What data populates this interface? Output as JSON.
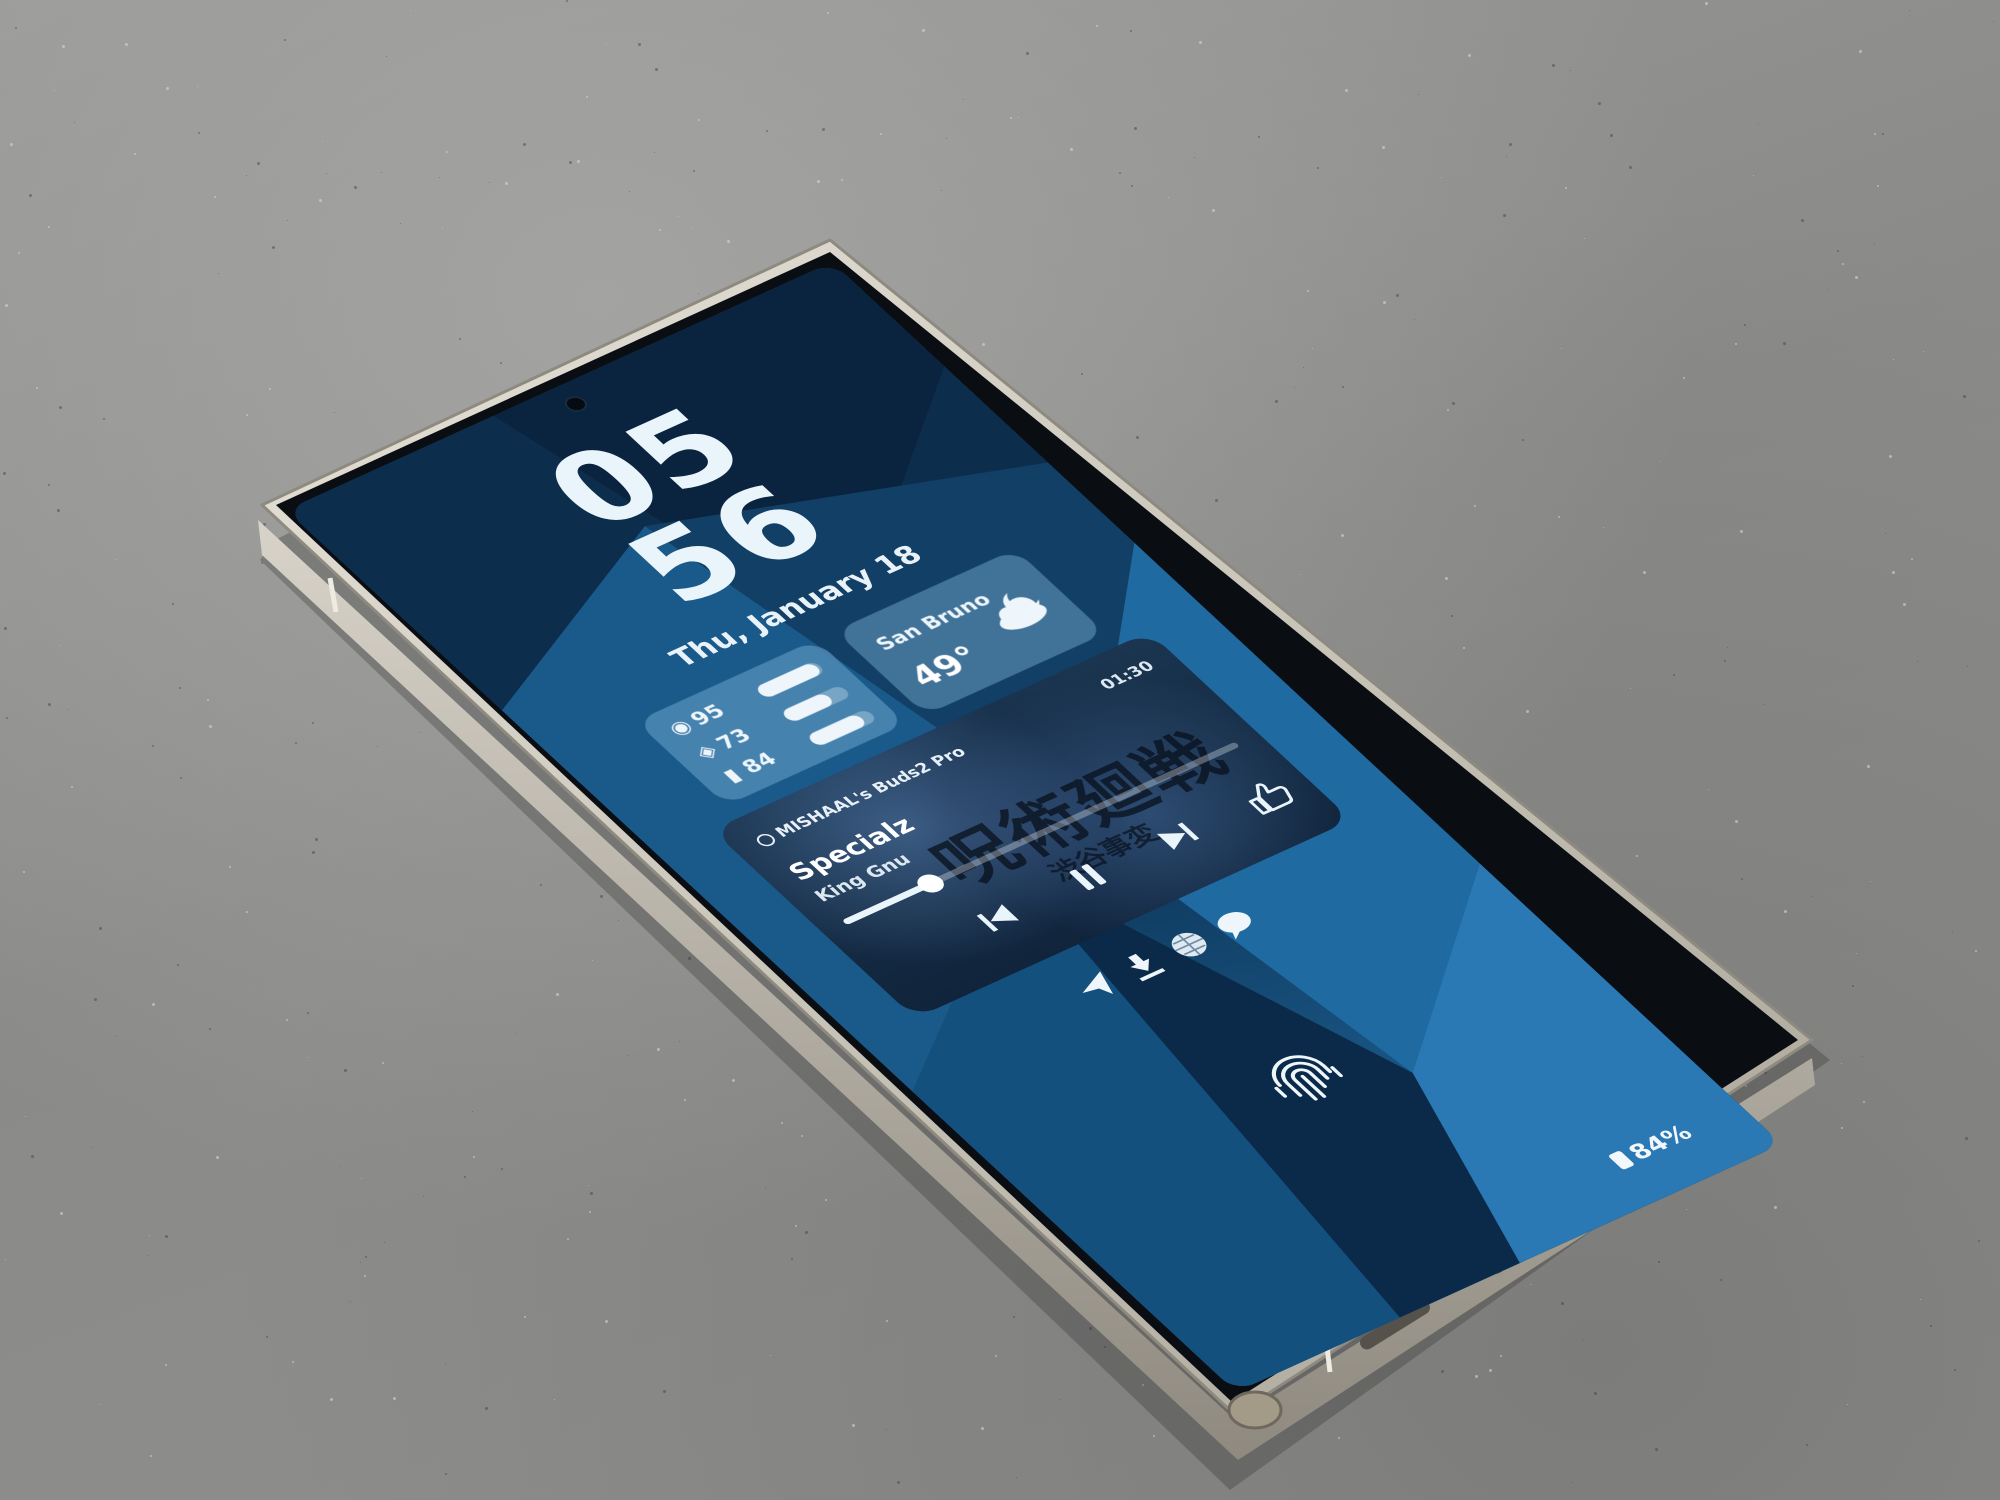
{
  "lockscreen": {
    "clock": {
      "hours": "05",
      "minutes": "56"
    },
    "date": "Thu, January 18",
    "battery_widget": {
      "rows": [
        {
          "icon": "earbuds-case-icon",
          "value": "95",
          "level": 0.95
        },
        {
          "icon": "earbuds-icon",
          "value": "73",
          "level": 0.73
        },
        {
          "icon": "phone-battery-icon",
          "value": "84",
          "level": 0.84
        }
      ]
    },
    "weather_widget": {
      "city": "San Bruno",
      "temperature": "49°",
      "icon": "cloudy-night-icon"
    },
    "media_player": {
      "output_device": "MISHAAL's Buds2 Pro",
      "track": "Specialz",
      "artist": "King Gnu",
      "elapsed": "01:30",
      "progress": 0.22,
      "album_art_text": "呪術廻戦",
      "album_art_subtext": "渋谷事変",
      "controls": [
        "previous-icon",
        "pause-icon",
        "next-icon",
        "thumbs-up-icon"
      ]
    },
    "status_icons": [
      "send-icon",
      "download-icon",
      "globe-icon",
      "chat-bubble-icon"
    ],
    "fingerprint_icon": "fingerprint-icon",
    "battery_percent": "84%"
  },
  "colors": {
    "wallpaper_base": "#174a73",
    "widget_tint": "#82b9e1",
    "text": "#eaf4fb",
    "phone_frame": "#cfcbc2",
    "table": "#8d8d8b"
  }
}
